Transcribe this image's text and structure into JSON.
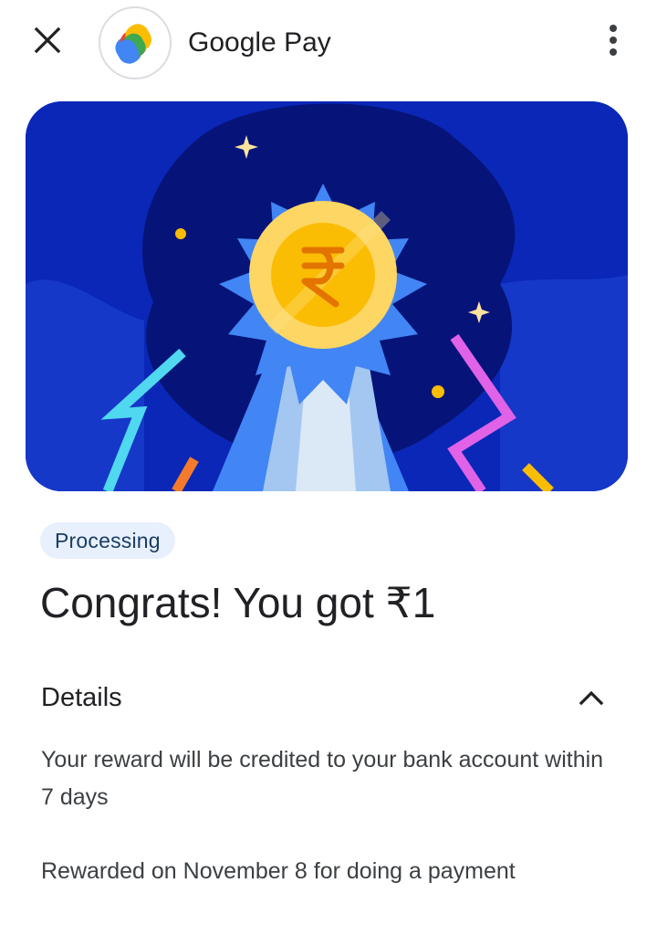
{
  "header": {
    "title": "Google Pay",
    "close_icon": "close-icon",
    "logo_icon": "google-pay-logo",
    "menu_icon": "more-vert-icon"
  },
  "hero": {
    "illustration": "reward-badge-coin",
    "coin_symbol": "₹",
    "colors": {
      "background": "#0a27b7",
      "blob": "#06147a",
      "badge": "#4285f4",
      "coin_outer": "#fdd663",
      "coin_inner": "#fbbc04",
      "symbol": "#e37400"
    }
  },
  "status": {
    "label": "Processing"
  },
  "reward": {
    "headline": "Congrats! You got ₹1"
  },
  "details": {
    "title": "Details",
    "chevron_icon": "chevron-up-icon",
    "expanded": true,
    "description": "Your reward will be credited to your bank account within 7 days",
    "rewarded_on": "Rewarded on November 8 for doing a payment"
  }
}
